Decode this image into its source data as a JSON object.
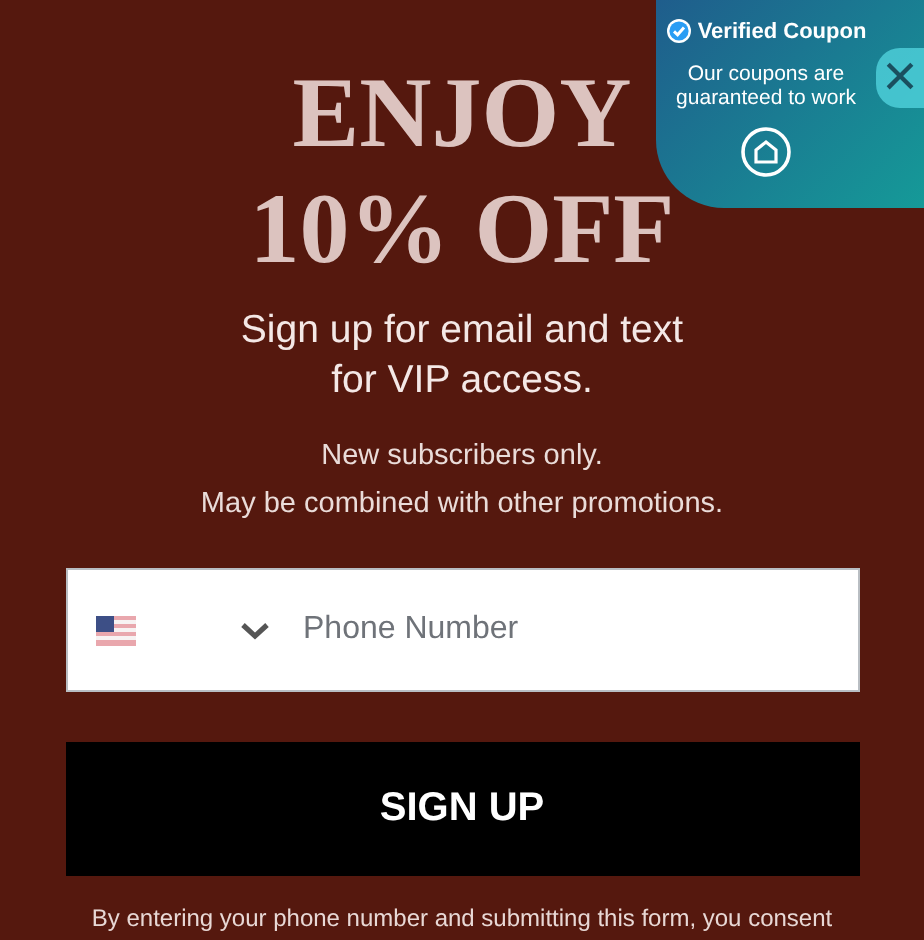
{
  "headline": [
    "ENJOY",
    "10% OFF"
  ],
  "subtitle": "Sign up for email and text for VIP access.",
  "notes": [
    "New subscribers only.",
    "May be combined with other promotions."
  ],
  "phone_field": {
    "placeholder": "Phone Number"
  },
  "submit_button": "SIGN UP",
  "disclaimer": "By entering your phone number and submitting this form, you consent",
  "coupon_badge": {
    "title": "Verified Coupon",
    "text": "Our coupons are guaranteed to work"
  },
  "close_button": "×"
}
